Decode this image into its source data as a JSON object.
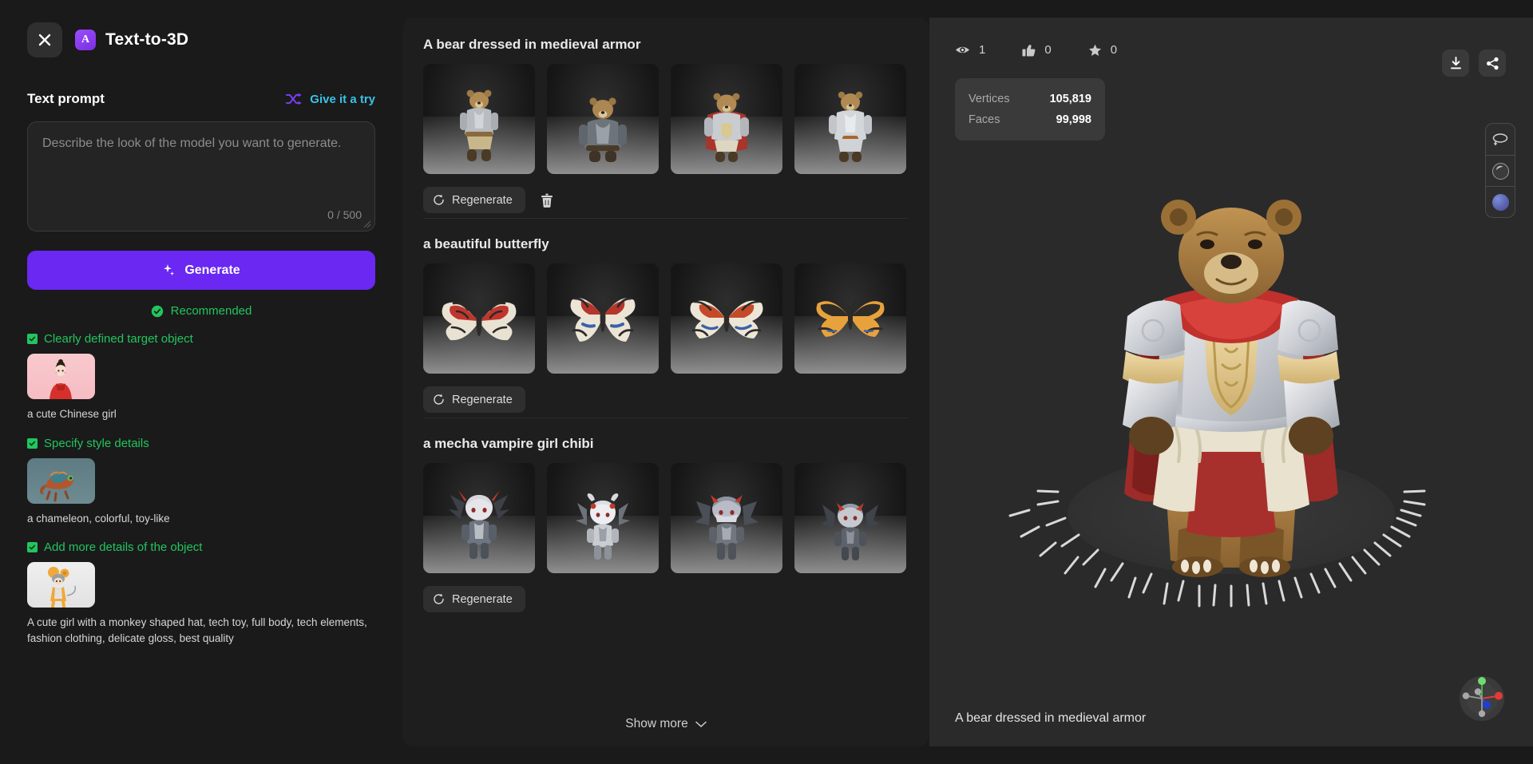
{
  "header": {
    "close_icon": "close-icon",
    "logo_letter": "A",
    "title": "Text-to-3D"
  },
  "sidebar": {
    "prompt_label": "Text prompt",
    "shuffle_icon": "shuffle-icon",
    "give_it_a_try": "Give it a try",
    "prompt_value": "",
    "prompt_placeholder": "Describe the look of the model you want to generate.",
    "char_counter": "0 / 500",
    "generate_label": "Generate",
    "generate_icon": "sparkle-icon",
    "generate_color": "#6a28f2",
    "recommended_label": "Recommended",
    "recommended_color": "#22c55e",
    "tips": [
      {
        "title": "Clearly defined target object",
        "caption": "a cute Chinese girl",
        "thumb": "chinese-girl-thumb"
      },
      {
        "title": "Specify style details",
        "caption": "a chameleon, colorful, toy-like",
        "thumb": "chameleon-thumb"
      },
      {
        "title": "Add more details of the object",
        "caption": "A cute girl with a monkey shaped hat, tech toy, full body, tech elements, fashion clothing, delicate gloss, best quality",
        "thumb": "monkey-hat-girl-thumb"
      }
    ]
  },
  "gallery": {
    "sections": [
      {
        "title": "A bear dressed in medieval armor",
        "regenerate_label": "Regenerate",
        "has_delete": true,
        "delete_icon": "trash-icon",
        "items": [
          "bear-armor-1",
          "bear-armor-2",
          "bear-armor-3",
          "bear-armor-4"
        ]
      },
      {
        "title": "a beautiful butterfly",
        "regenerate_label": "Regenerate",
        "has_delete": false,
        "items": [
          "butterfly-1",
          "butterfly-2",
          "butterfly-3",
          "butterfly-4"
        ]
      },
      {
        "title": "a mecha vampire girl chibi",
        "regenerate_label": "Regenerate",
        "has_delete": false,
        "items": [
          "mecha-chibi-1",
          "mecha-chibi-2",
          "mecha-chibi-3",
          "mecha-chibi-4"
        ]
      }
    ],
    "show_more_label": "Show more",
    "show_more_icon": "chevron-down-icon"
  },
  "viewer": {
    "stats": [
      {
        "icon": "eye-icon",
        "value": "1"
      },
      {
        "icon": "thumbs-up-icon",
        "value": "0"
      },
      {
        "icon": "star-icon",
        "value": "0"
      }
    ],
    "meta": [
      {
        "key": "Vertices",
        "value": "105,819"
      },
      {
        "key": "Faces",
        "value": "99,998"
      }
    ],
    "actions": [
      {
        "icon": "download-icon"
      },
      {
        "icon": "share-icon"
      }
    ],
    "view_tools": [
      {
        "icon": "rotate-icon"
      },
      {
        "icon": "material-sphere-icon"
      },
      {
        "icon": "environment-sphere-icon"
      }
    ],
    "model_caption": "A bear dressed in medieval armor",
    "gizmo_icon": "axis-gizmo"
  }
}
